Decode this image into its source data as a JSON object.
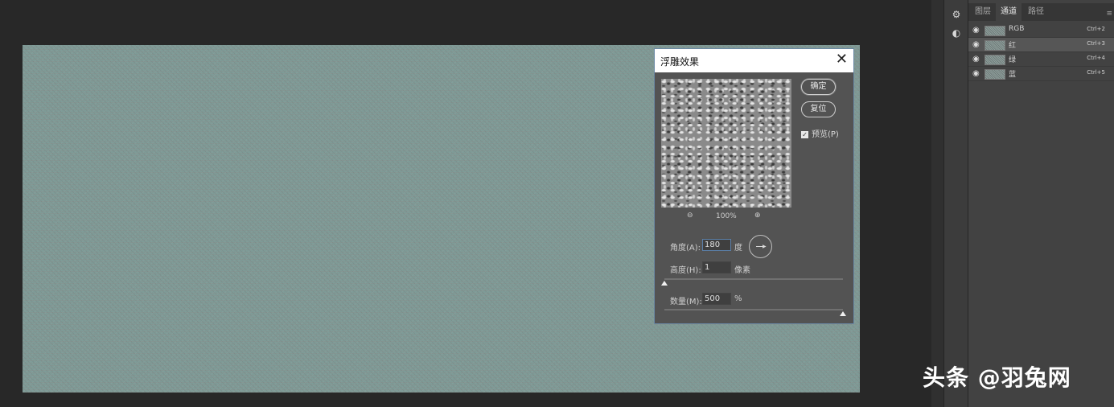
{
  "dialog": {
    "title": "浮雕效果",
    "close_glyph": "✕",
    "zoom_out_glyph": "⊖",
    "zoom_in_glyph": "⊕",
    "zoom_level": "100%",
    "ok_label": "确定",
    "reset_label": "复位",
    "preview_label": "预览(P)",
    "preview_checked": true,
    "angle_label": "角度(A):",
    "angle_value": "180",
    "angle_unit": "度",
    "height_label": "高度(H):",
    "height_value": "1",
    "height_unit": "像素",
    "height_slider_fraction": 0.0,
    "amount_label": "数量(M):",
    "amount_value": "500",
    "amount_unit": "%",
    "amount_slider_fraction": 1.0
  },
  "panel": {
    "tabs": [
      "图层",
      "通道",
      "路径"
    ],
    "active_tab": 1,
    "menu_glyph": "≡",
    "channels": [
      {
        "name": "RGB",
        "shortcut": "Ctrl+2",
        "selected": false
      },
      {
        "name": "红",
        "shortcut": "Ctrl+3",
        "selected": true
      },
      {
        "name": "绿",
        "shortcut": "Ctrl+4",
        "selected": false
      },
      {
        "name": "蓝",
        "shortcut": "Ctrl+5",
        "selected": false
      }
    ]
  },
  "tools": {
    "properties_icon": "properties-icon",
    "adjustments_icon": "adjustments-icon"
  },
  "watermark": "头条 @羽兔网",
  "colors": {
    "canvas_noise": "#7f9995",
    "dialog_bg": "#535353",
    "panel_bg": "#424242",
    "app_bg": "#282828"
  }
}
